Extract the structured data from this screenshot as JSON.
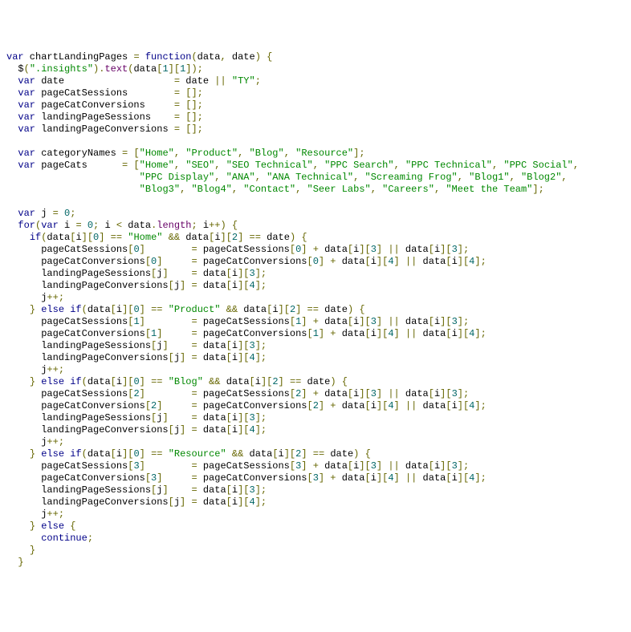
{
  "code": {
    "fnName": "chartLandingPages",
    "args": [
      "data",
      "date"
    ],
    "selector": ".insights",
    "textArg": "data[1][1]",
    "dateDefault": "TY",
    "decls": [
      "pageCatSessions",
      "pageCatConversions",
      "landingPageSessions",
      "landingPageConversions"
    ],
    "categoryNames": [
      "Home",
      "Product",
      "Blog",
      "Resource"
    ],
    "pageCats": [
      "Home",
      "SEO",
      "SEO Technical",
      "PPC Search",
      "PPC Technical",
      "PPC Social",
      "PPC Display",
      "ANA",
      "ANA Technical",
      "Screaming Frog",
      "Blog1",
      "Blog2",
      "Blog3",
      "Blog4",
      "Contact",
      "Seer Labs",
      "Careers",
      "Meet the Team"
    ],
    "loopVarJ": "j",
    "loopVarI": "i",
    "branches": [
      {
        "cat": "Home",
        "idx": 0
      },
      {
        "cat": "Product",
        "idx": 1
      },
      {
        "cat": "Blog",
        "idx": 2
      },
      {
        "cat": "Resource",
        "idx": 3
      }
    ],
    "dxSessions": 3,
    "dxConversions": 4
  }
}
